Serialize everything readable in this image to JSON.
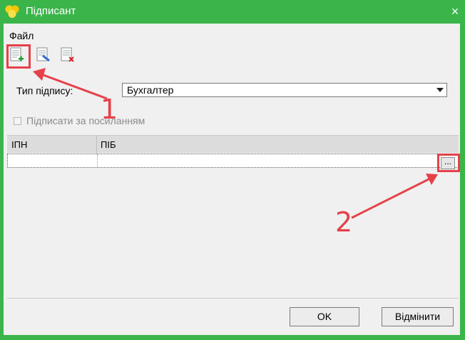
{
  "window": {
    "title": "Підписант",
    "close_glyph": "×",
    "colors": {
      "titlebar": "#3bb54a",
      "client": "#f0f0f0",
      "annotation": "#e5414b"
    }
  },
  "menu": {
    "file_label": "Файл"
  },
  "toolbar": {
    "icons": [
      "add-document-icon",
      "edit-document-icon",
      "delete-document-icon"
    ]
  },
  "form": {
    "signature_type_label": "Тип підпису:",
    "signature_type_value": "Бухгалтер",
    "sign_by_reference_label": "Підписати за посиланням"
  },
  "grid": {
    "columns": [
      "ІПН",
      "ПІБ"
    ],
    "rows": [
      [
        "",
        ""
      ]
    ],
    "ellipsis_label": "..."
  },
  "footer": {
    "ok_label": "OK",
    "cancel_label": "Відмінити"
  },
  "annotations": {
    "marker_1": "1",
    "marker_2": "2"
  }
}
